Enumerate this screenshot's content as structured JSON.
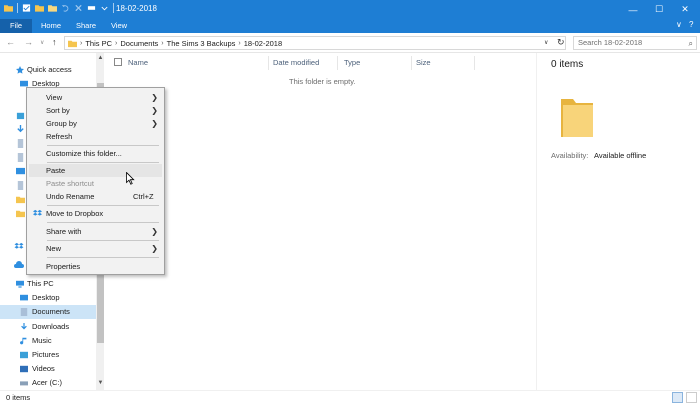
{
  "window": {
    "title": "18-02-2018",
    "controls": {
      "minimize": "—",
      "maximize": "☐",
      "close": "✕"
    }
  },
  "ribbon": {
    "tabs": [
      {
        "label": "File"
      },
      {
        "label": "Home"
      },
      {
        "label": "Share"
      },
      {
        "label": "View"
      }
    ],
    "collapse": "∨",
    "help": "?"
  },
  "address": {
    "back": "←",
    "forward": "→",
    "recent": "∨",
    "up": "↑",
    "crumbs": [
      "This PC",
      "Documents",
      "The Sims 3 Backups",
      "18-02-2018"
    ],
    "dropdown": "∨",
    "refresh": "↻",
    "search_placeholder": "Search 18-02-2018",
    "search_icon": "⌕"
  },
  "navpane": {
    "quick_access": "Quick access",
    "desktop_pinned": "Desktop",
    "this_pc": "This PC",
    "items": [
      "Desktop",
      "Documents",
      "Downloads",
      "Music",
      "Pictures",
      "Videos",
      "Acer (C:)"
    ]
  },
  "columns": {
    "name": "Name",
    "date_modified": "Date modified",
    "type": "Type",
    "size": "Size"
  },
  "content": {
    "empty_message": "This folder is empty."
  },
  "details": {
    "count": "0 items",
    "availability_label": "Availability:",
    "availability_value": "Available offline"
  },
  "status": {
    "items": "0 items"
  },
  "context_menu": {
    "view": "View",
    "sort_by": "Sort by",
    "group_by": "Group by",
    "refresh": "Refresh",
    "customize": "Customize this folder...",
    "paste": "Paste",
    "paste_shortcut": "Paste shortcut",
    "undo_rename": "Undo Rename",
    "undo_shortcut": "Ctrl+Z",
    "move_to_dropbox": "Move to Dropbox",
    "share_with": "Share with",
    "new": "New",
    "properties": "Properties",
    "submenu_arrow": "❯"
  },
  "colors": {
    "titlebar": "#1e7ed4",
    "file_tab": "#1561aa",
    "selection": "#cce4f7",
    "folder": "#f5c54f"
  }
}
